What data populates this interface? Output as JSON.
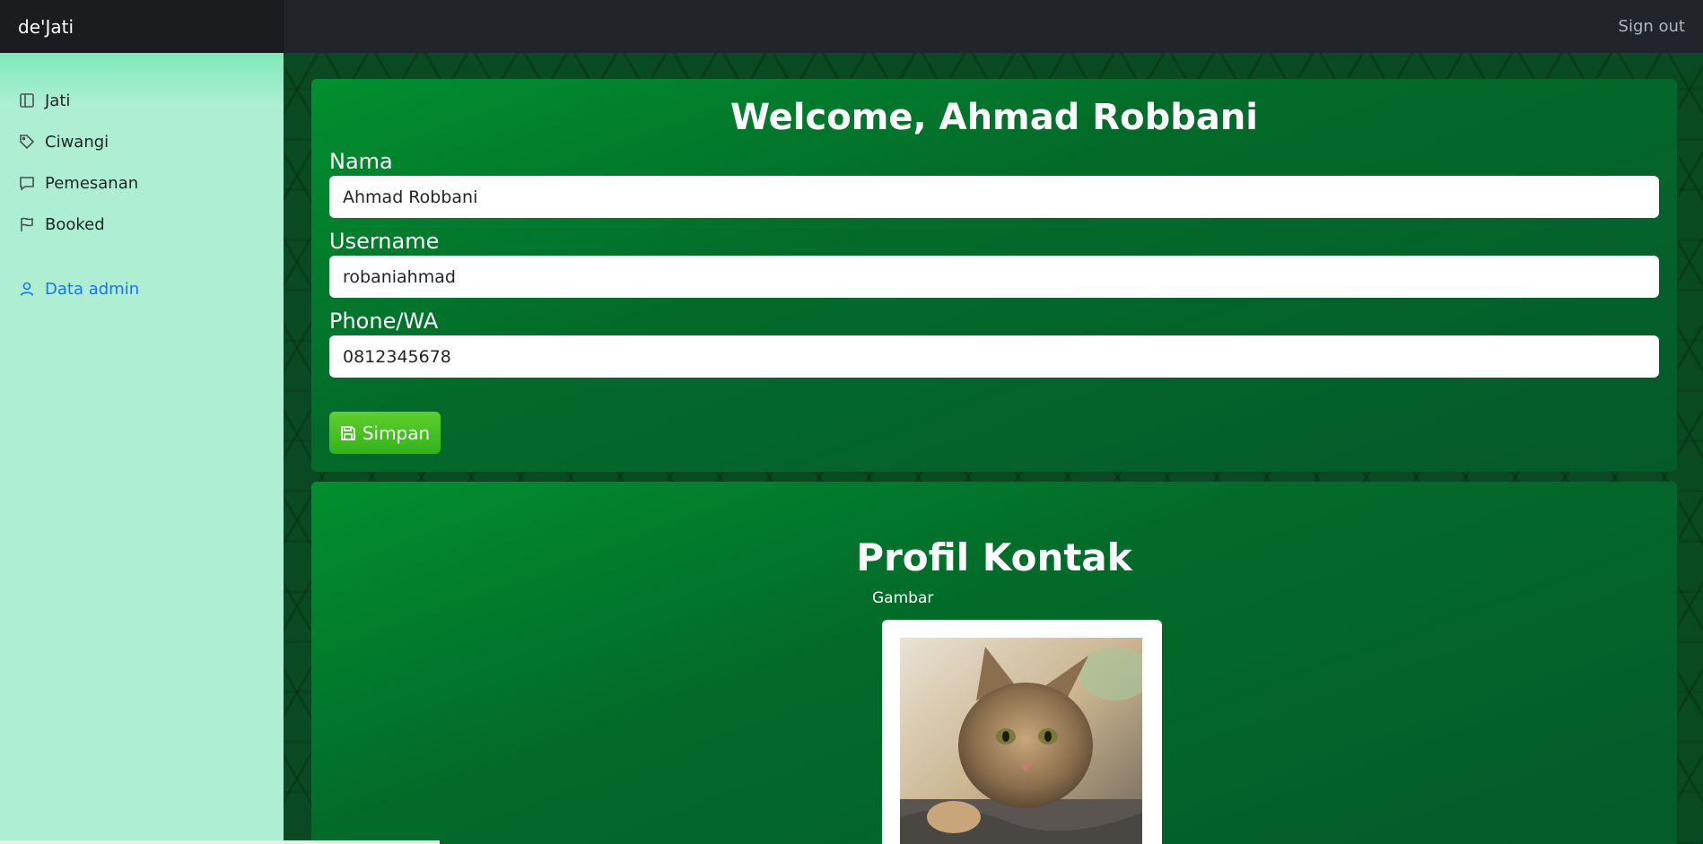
{
  "navbar": {
    "brand": "de'Jati",
    "signout": "Sign out"
  },
  "sidebar": {
    "items": [
      {
        "label": "Jati",
        "icon": "layout-icon"
      },
      {
        "label": "Ciwangi",
        "icon": "tag-icon"
      },
      {
        "label": "Pemesanan",
        "icon": "chat-icon"
      },
      {
        "label": "Booked",
        "icon": "flag-icon"
      }
    ],
    "admin": {
      "label": "Data admin",
      "icon": "user-icon"
    }
  },
  "form": {
    "welcome": "Welcome, Ahmad Robbani",
    "nama_label": "Nama",
    "nama_value": "Ahmad Robbani",
    "username_label": "Username",
    "username_value": "robaniahmad",
    "phone_label": "Phone/WA",
    "phone_value": "0812345678",
    "save_label": "Simpan"
  },
  "profil": {
    "title": "Profil Kontak",
    "gambar_label": "Gambar"
  },
  "colors": {
    "navbar": "#212529",
    "sidebar": "#aeefd3",
    "card_green": "#018f2f",
    "save_button": "#33b31c",
    "active_link": "#1a73e8"
  }
}
